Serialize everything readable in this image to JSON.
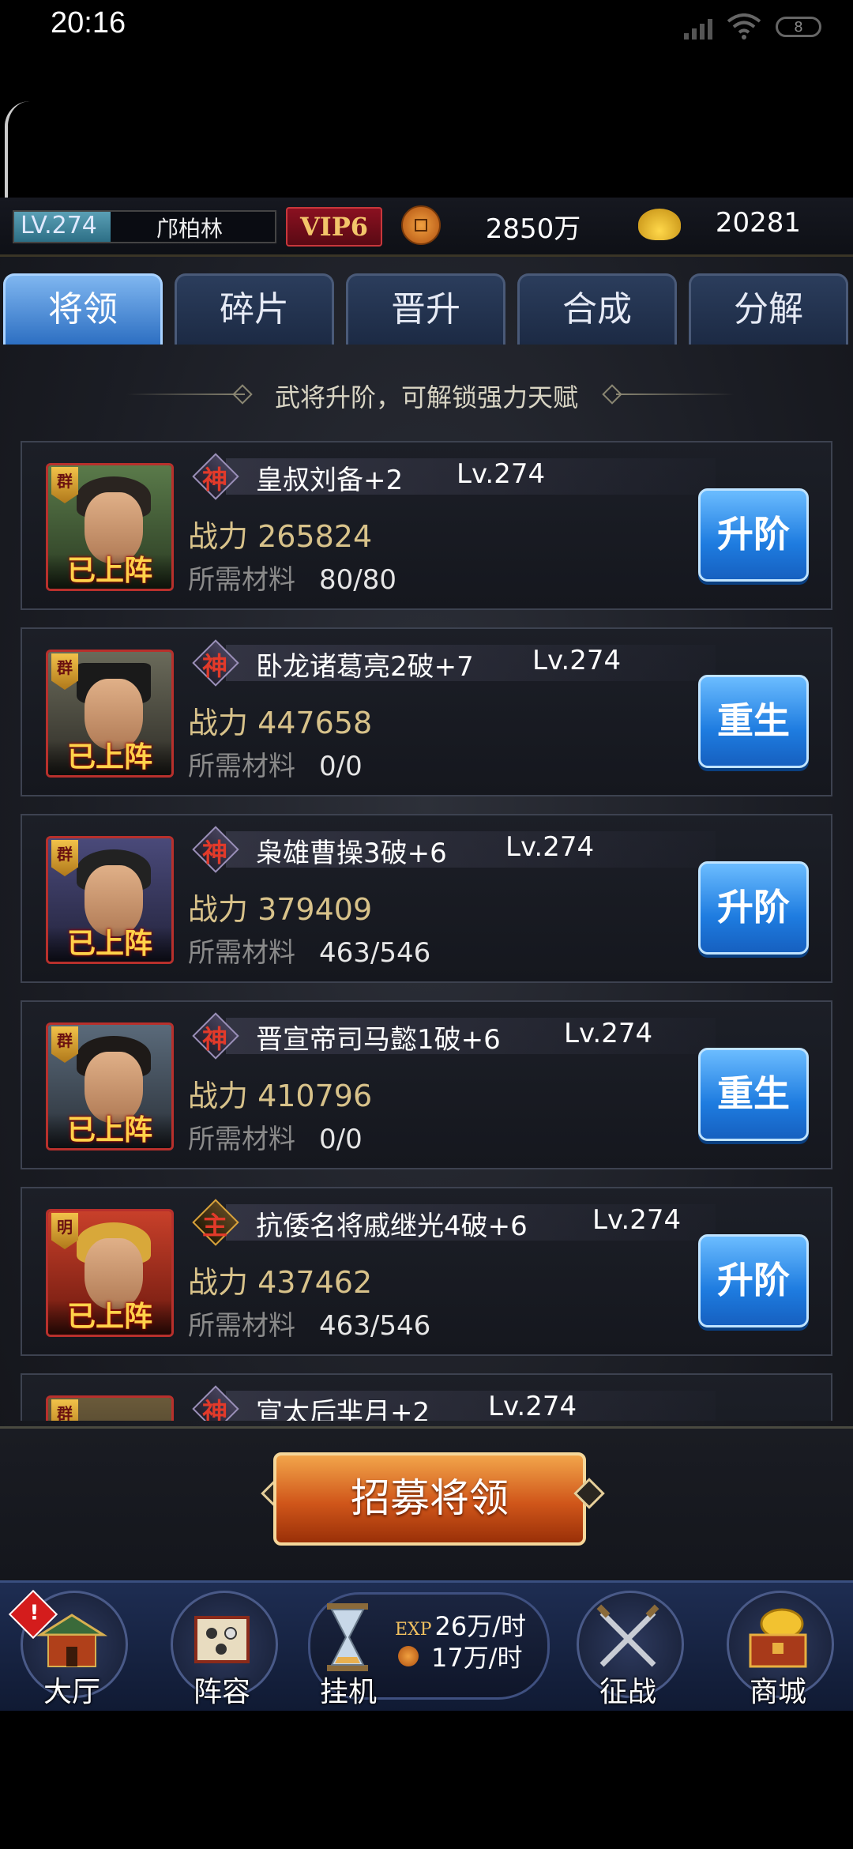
{
  "status": {
    "time": "20:16",
    "battery": "8"
  },
  "header": {
    "level": "LV.274",
    "level_progress": 0.37,
    "player_name": "邝柏林",
    "vip": "VIP6",
    "coins": "2850万",
    "ingots": "20281"
  },
  "tabs": [
    "将领",
    "碎片",
    "晋升",
    "合成",
    "分解"
  ],
  "active_tab": 0,
  "subtitle": "武将升阶，可解锁强力天赋",
  "cards": [
    {
      "faction": "群",
      "rank": "神",
      "name": "皇叔刘备+2",
      "level": "Lv.274",
      "power": "战力 265824",
      "materials_label": "所需材料",
      "materials": "80/80",
      "deployed": "已上阵",
      "action": "升阶"
    },
    {
      "faction": "群",
      "rank": "神",
      "name": "卧龙诸葛亮2破+7",
      "level": "Lv.274",
      "power": "战力 447658",
      "materials_label": "所需材料",
      "materials": "0/0",
      "deployed": "已上阵",
      "action": "重生"
    },
    {
      "faction": "群",
      "rank": "神",
      "name": "枭雄曹操3破+6",
      "level": "Lv.274",
      "power": "战力 379409",
      "materials_label": "所需材料",
      "materials": "463/546",
      "deployed": "已上阵",
      "action": "升阶"
    },
    {
      "faction": "群",
      "rank": "神",
      "name": "晋宣帝司马懿1破+6",
      "level": "Lv.274",
      "power": "战力 410796",
      "materials_label": "所需材料",
      "materials": "0/0",
      "deployed": "已上阵",
      "action": "重生"
    },
    {
      "faction": "明",
      "rank": "主",
      "name": "抗倭名将戚继光4破+6",
      "level": "Lv.274",
      "power": "战力 437462",
      "materials_label": "所需材料",
      "materials": "463/546",
      "deployed": "已上阵",
      "action": "升阶"
    },
    {
      "faction": "群",
      "rank": "神",
      "name": "宣太后芈月+2",
      "level": "Lv.274",
      "power": "",
      "materials_label": "",
      "materials": "",
      "deployed": "",
      "action": ""
    }
  ],
  "recruit_button": "招募将领",
  "nav": {
    "hall": "大厅",
    "lineup": "阵容",
    "idle": "挂机",
    "idle_exp_tag": "EXP",
    "idle_exp": "26万/时",
    "idle_coin": "17万/时",
    "battle": "征战",
    "shop": "商城",
    "alert": "!"
  },
  "colors": {
    "accent_blue": "#1e7ce0",
    "gold_text": "#d8c28a",
    "deployed_text": "#ffd24a"
  }
}
